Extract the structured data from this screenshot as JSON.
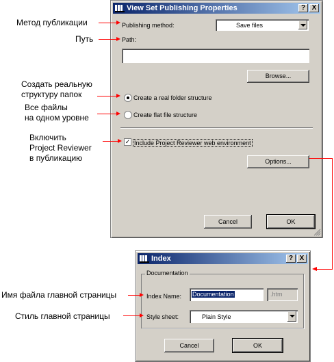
{
  "main_dialog": {
    "title": "View Set Publishing Properties",
    "help_btn": "?",
    "close_btn": "X",
    "publishing_method_label": "Publishing method:",
    "publishing_method_value": "Save files",
    "path_label": "Path:",
    "path_value": "",
    "browse_btn": "Browse...",
    "radio_real_folder": "Create a real folder structure",
    "radio_flat_file": "Create flat file structure",
    "checkbox_reviewer": "Include Project Reviewer web environment",
    "options_btn": "Options...",
    "cancel_btn": "Cancel",
    "ok_btn": "OK",
    "real_folder_selected": true,
    "reviewer_checked": true
  },
  "index_dialog": {
    "title": "Index",
    "help_btn": "?",
    "close_btn": "X",
    "group_title": "Documentation",
    "index_name_label": "Index Name:",
    "index_name_value": "Documentation",
    "extension": ".htm",
    "style_sheet_label": "Style sheet:",
    "style_sheet_value": "Plain Style",
    "cancel_btn": "Cancel",
    "ok_btn": "OK"
  },
  "annotations": {
    "method": "Метод публикации",
    "path": "Путь",
    "real_folders_line1": "Создать реальную",
    "real_folders_line2": "структуру папок",
    "flat_line1": "Все файлы",
    "flat_line2": "на одном уровне",
    "reviewer_line1": "Включить",
    "reviewer_line2": "Project Reviewer",
    "reviewer_line3": "в публикацию",
    "index_name": "Имя файла главной страницы",
    "style": "Стиль главной страницы"
  },
  "colors": {
    "dialog_bg": "#d4d0c8",
    "title_start": "#0a246a",
    "title_end": "#a6caf0",
    "annotation_arrow": "#ff0000"
  }
}
